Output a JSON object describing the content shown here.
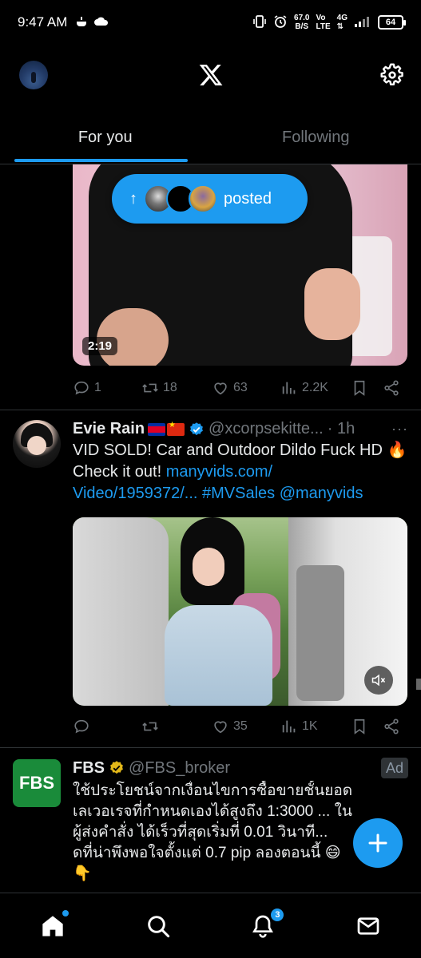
{
  "status_bar": {
    "time": "9:47 AM",
    "speed_top": "67.0",
    "speed_bottom": "B/S",
    "net_top": "Vo",
    "net_bottom": "LTE",
    "net_gen": "4G",
    "battery": "64"
  },
  "header": {
    "logo_icon": "x-logo-icon",
    "settings_icon": "gear-icon"
  },
  "tabs": [
    {
      "label": "For you",
      "active": true
    },
    {
      "label": "Following",
      "active": false
    }
  ],
  "posted_pill": {
    "arrow": "↑",
    "label": "posted"
  },
  "post1": {
    "duration": "2:19",
    "replies": "1",
    "reposts": "18",
    "likes": "63",
    "views": "2.2K"
  },
  "post2": {
    "name": "Evie Rain",
    "handle": "@xcorpsekitte...",
    "time": "· 1h",
    "more": "···",
    "text_plain": "VID SOLD! Car and Outdoor Dildo Fuck HD 🔥 Check it out! ",
    "link1": "manyvids.com/",
    "link2": "Video/1959372/...",
    "hashtag": "#MVSales",
    "mention": "@manyvids",
    "replies": "",
    "reposts": "",
    "likes": "35",
    "views": "1K"
  },
  "post3": {
    "logo_text": "FBS",
    "name": "FBS",
    "handle": "@FBS_broker",
    "ad_label": "Ad",
    "line1": "ใช้ประโยชน์จากเงื่อนไขการซื้อขายชั้นยอด",
    "line2": "เลเวอเรจที่กำหนดเองได้สูงถึง 1:3000 ... ใน",
    "line3": "ผู้ส่งคำสั่ง ได้เร็วที่สุดเริ่มที่ 0.01 วินาที...",
    "line4": "ดที่น่าพึงพอใจตั้งแต่ 0.7 pip ลองตอนนี้ 😄",
    "line5": "👇"
  },
  "bottom_nav": {
    "notifications_count": "3"
  },
  "colors": {
    "accent": "#1d9bf0",
    "background": "#000000",
    "muted": "#71767b"
  }
}
